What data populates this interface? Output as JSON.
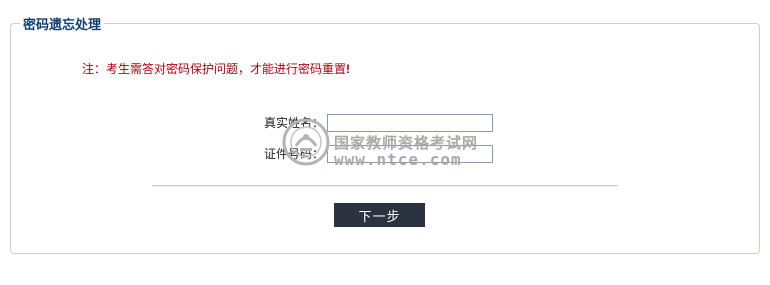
{
  "panel": {
    "title": "密码遗忘处理"
  },
  "notice": {
    "text": "注：考生需答对密码保护问题，才能进行密码重置",
    "mark": "!",
    "color": "#b3000f"
  },
  "form": {
    "name_label": "真实姓名：",
    "name_value": "",
    "id_label": "证件号码：",
    "id_value": "",
    "next_label": "下一步"
  },
  "watermark": {
    "line1": "国家教师资格考试网",
    "line2": "www.ntce.com"
  },
  "colors": {
    "title": "#0e3f70",
    "notice": "#b3000f",
    "button_bg": "#2c3340"
  }
}
